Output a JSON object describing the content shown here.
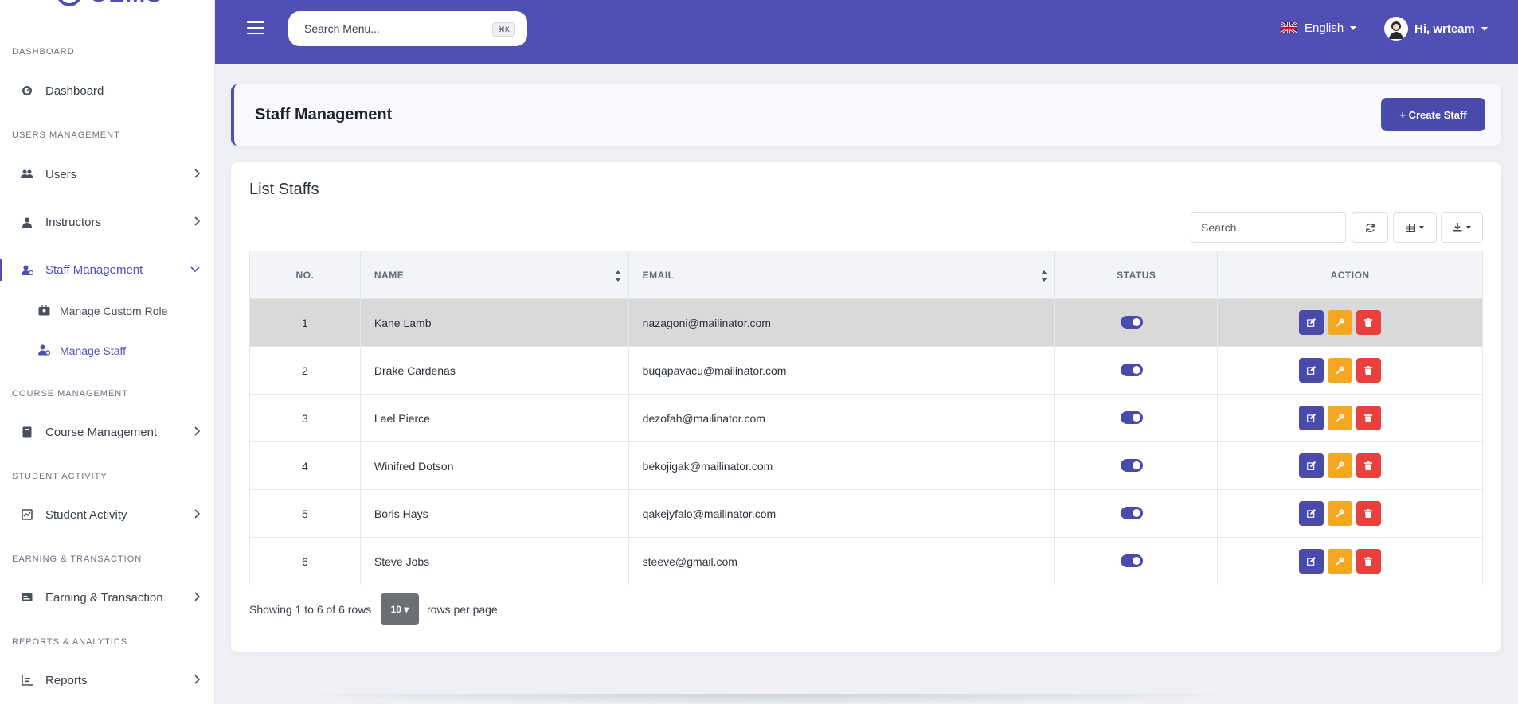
{
  "sidebar": {
    "logo_text": "OEMS",
    "sections": {
      "dashboard": "DASHBOARD",
      "users_management": "USERS MANAGEMENT",
      "course_management": "COURSE MANAGEMENT",
      "student_activity": "STUDENT ACTIVITY",
      "earning_transaction": "EARNING & TRANSACTION",
      "reports_analytics": "REPORTS & ANALYTICS"
    },
    "items": {
      "dashboard": "Dashboard",
      "users": "Users",
      "instructors": "Instructors",
      "staff_management": "Staff Management",
      "manage_custom_role": "Manage Custom Role",
      "manage_staff": "Manage Staff",
      "course_management": "Course Management",
      "student_activity": "Student Activity",
      "earning_transaction": "Earning & Transaction",
      "reports": "Reports"
    }
  },
  "topbar": {
    "search_placeholder": "Search Menu...",
    "shortcut": "⌘K",
    "language": "English",
    "greeting": "Hi, wrteam"
  },
  "header": {
    "title": "Staff Management",
    "create_label": "+ Create Staff"
  },
  "list": {
    "title": "List Staffs",
    "search_placeholder": "Search",
    "columns": {
      "no": "NO.",
      "name": "NAME",
      "email": "EMAIL",
      "status": "STATUS",
      "action": "ACTION"
    },
    "rows": [
      {
        "no": "1",
        "name": "Kane Lamb",
        "email": "nazagoni@mailinator.com",
        "status": true
      },
      {
        "no": "2",
        "name": "Drake Cardenas",
        "email": "buqapavacu@mailinator.com",
        "status": true
      },
      {
        "no": "3",
        "name": "Lael Pierce",
        "email": "dezofah@mailinator.com",
        "status": true
      },
      {
        "no": "4",
        "name": "Winifred Dotson",
        "email": "bekojigak@mailinator.com",
        "status": true
      },
      {
        "no": "5",
        "name": "Boris Hays",
        "email": "qakejyfalo@mailinator.com",
        "status": true
      },
      {
        "no": "6",
        "name": "Steve Jobs",
        "email": "steeve@gmail.com",
        "status": true
      }
    ],
    "showing": "Showing 1 to 6 of 6 rows",
    "per_page": "10",
    "per_page_suffix": "rows per page"
  },
  "colors": {
    "primary": "#5050b4",
    "edit": "#4a4aab",
    "key": "#f5a623",
    "delete": "#e8403d",
    "highlight_row": "#d9d9d9"
  }
}
